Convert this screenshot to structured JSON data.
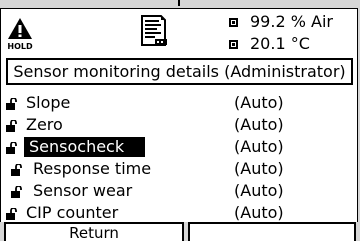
{
  "header": {
    "hold_icon": "hold-warning-icon",
    "hold_label": "HOLD",
    "doc_icon": "document-parameter-icon",
    "readings": [
      {
        "value": "99.2 % Air"
      },
      {
        "value": "20.1 °C"
      }
    ]
  },
  "title": "Sensor monitoring details (Administrator)",
  "items": [
    {
      "label": "Slope",
      "value": "(Auto)",
      "icon": "lock-open-icon"
    },
    {
      "label": "Zero",
      "value": "(Auto)",
      "icon": "lock-open-icon"
    },
    {
      "label": "Sensocheck",
      "value": "(Auto)",
      "icon": "lock-open-icon",
      "selected": true
    },
    {
      "label": "Response time",
      "value": "(Auto)",
      "icon": "lock-open-icon"
    },
    {
      "label": "Sensor wear",
      "value": "(Auto)",
      "icon": "lock-open-icon"
    },
    {
      "label": "CIP counter",
      "value": "(Auto)",
      "icon": "lock-open-icon"
    }
  ],
  "softkeys": {
    "left_label": "Return",
    "right_label": ""
  }
}
